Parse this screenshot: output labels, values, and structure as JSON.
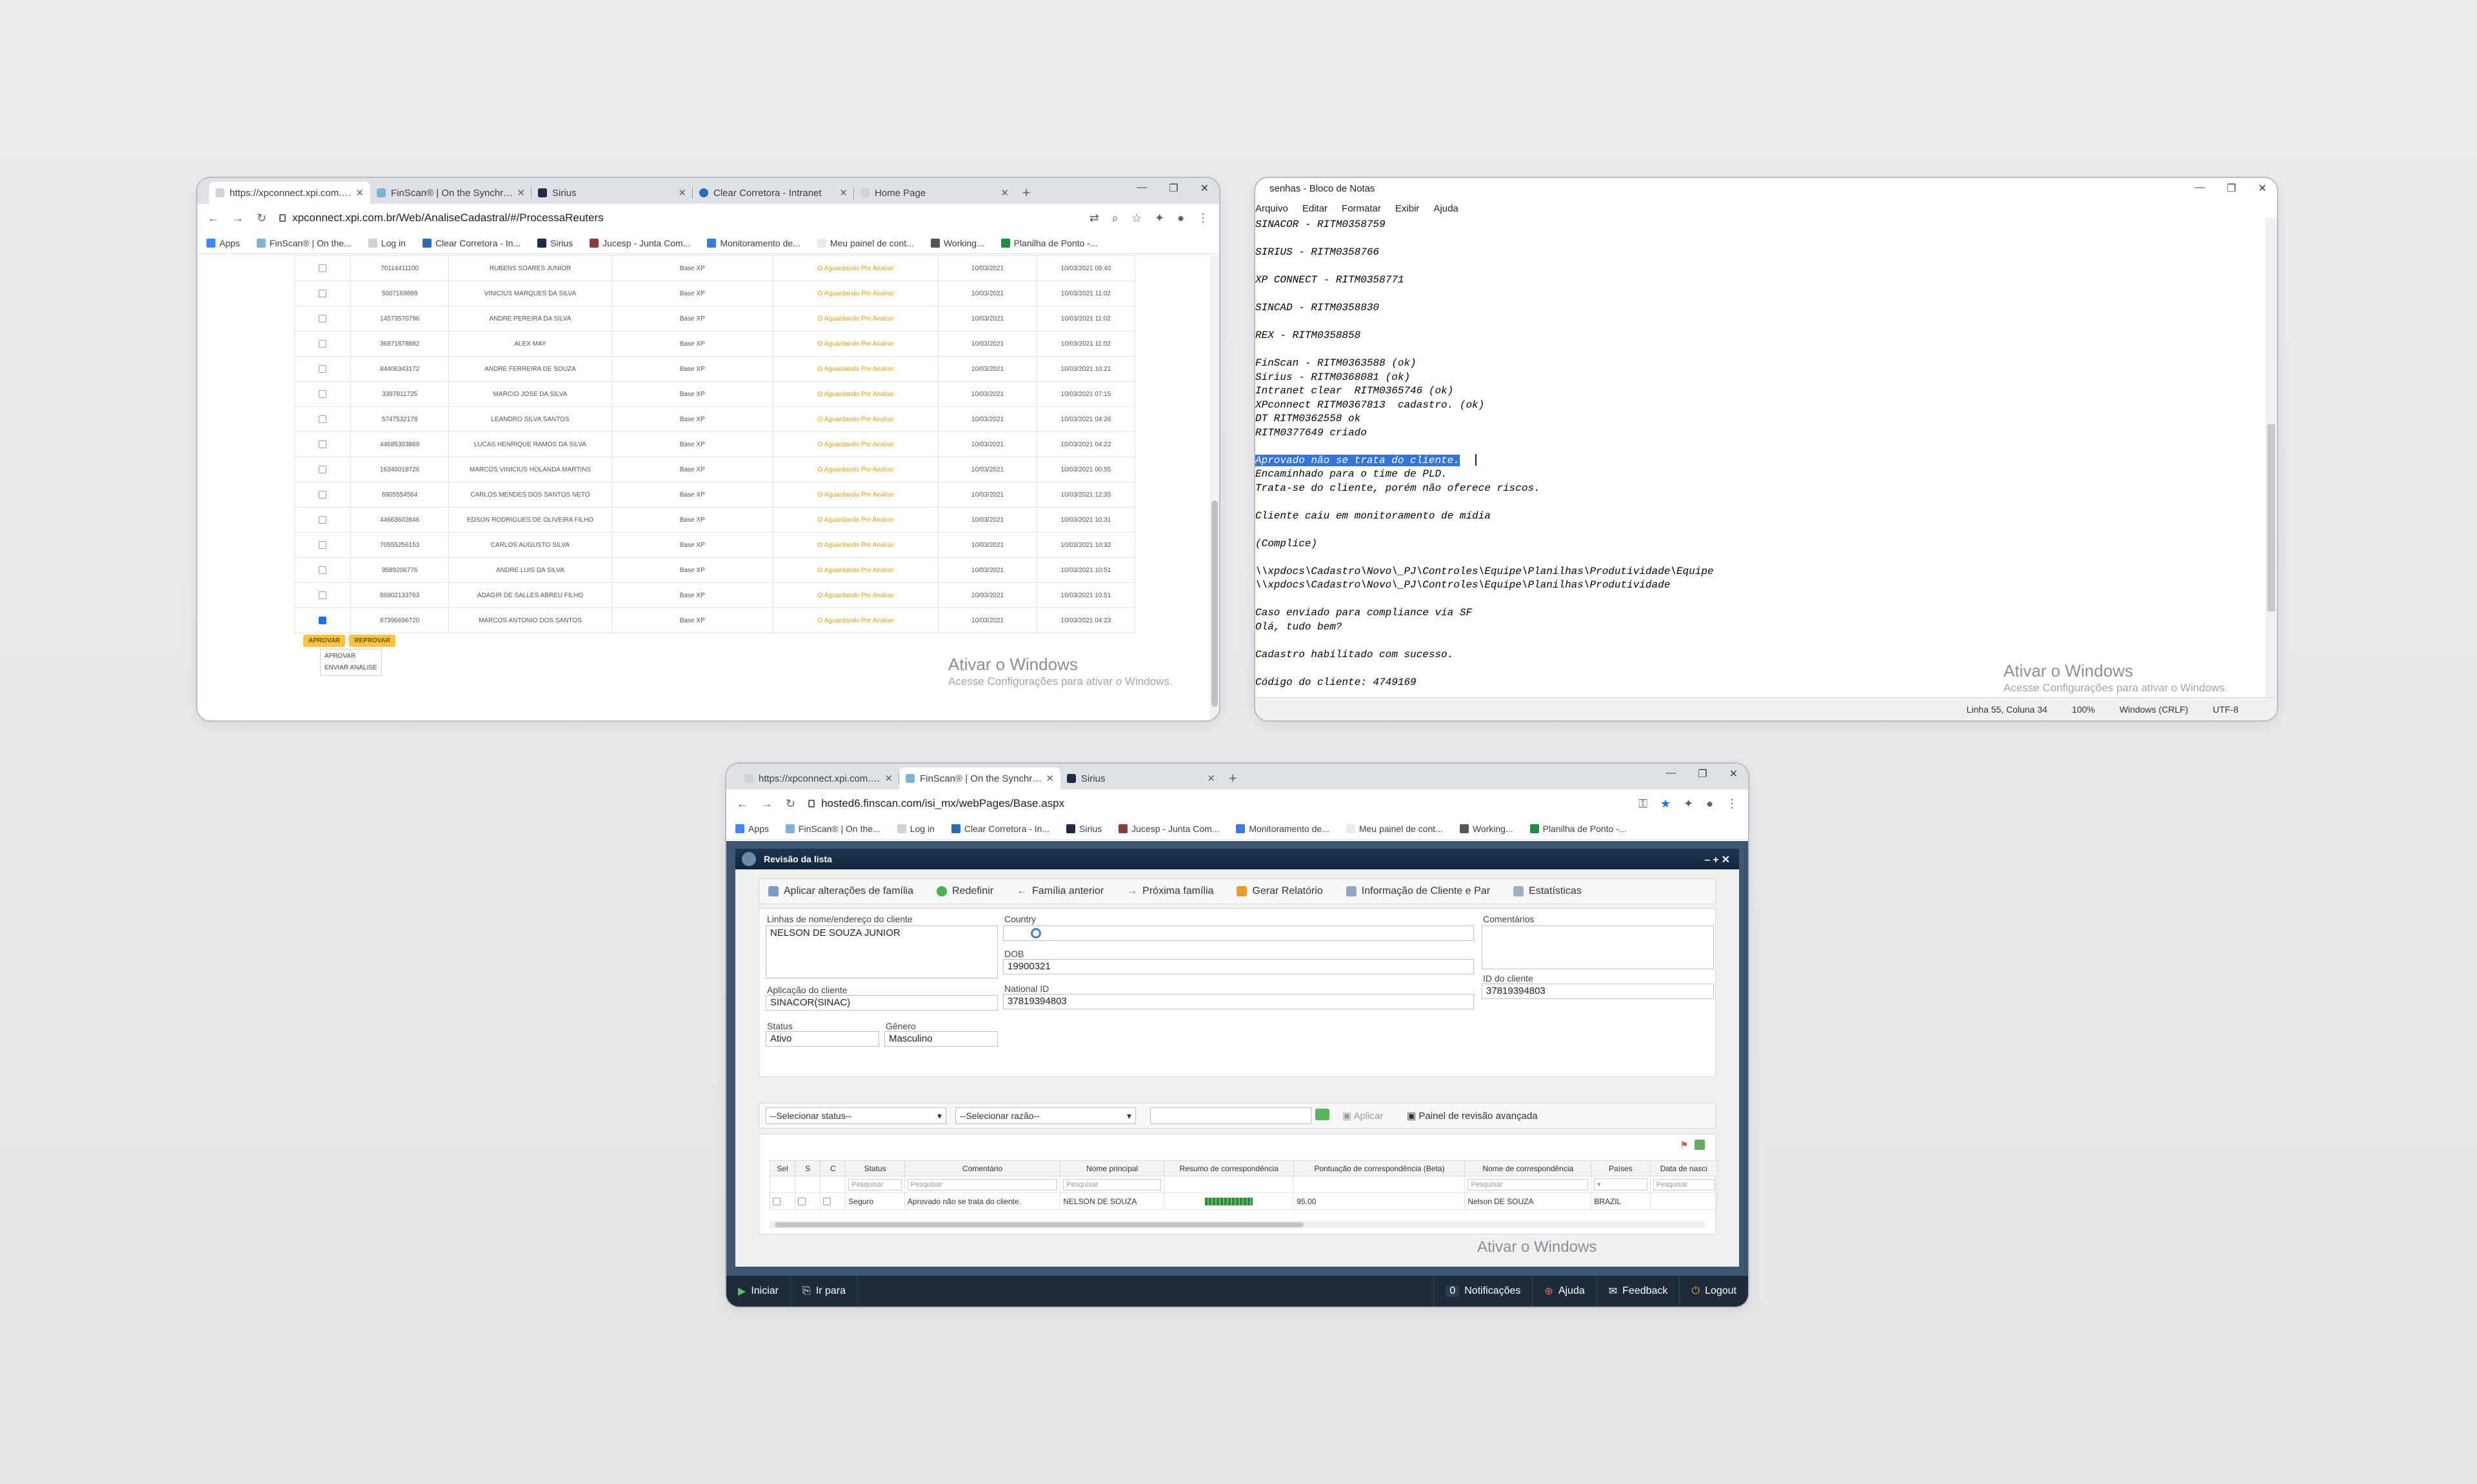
{
  "window1": {
    "tabs": [
      {
        "title": "https://xpconnect.xpi.com.br/Web",
        "active": true
      },
      {
        "title": "FinScan® | On the Synchronos",
        "active": false
      },
      {
        "title": "Sirius",
        "active": false
      },
      {
        "title": "Clear Corretora - Intranet",
        "active": false
      },
      {
        "title": "Home Page",
        "active": false
      }
    ],
    "url": "xpconnect.xpi.com.br/Web/AnaliseCadastral/#/ProcessaReuters",
    "bookmarks": [
      "Apps",
      "FinScan® | On the...",
      "Log in",
      "Clear Corretora - In...",
      "Sirius",
      "Jucesp - Junta Com...",
      "Monitoramento de...",
      "Meu painel de cont...",
      "Working...",
      "Planilha de Ponto -..."
    ],
    "rows": [
      {
        "id": "70114411100",
        "name": "RUBENS SOARES JUNIOR",
        "base": "Base XP",
        "status": "O Aguardando Pre Analise",
        "date": "10/03/2021",
        "datetime": "10/03/2021 09:40",
        "checked": false
      },
      {
        "id": "5007169899",
        "name": "VINICIUS MARQUES DA SILVA",
        "base": "Base XP",
        "status": "O Aguardando Pre Analise",
        "date": "10/03/2021",
        "datetime": "10/03/2021 11:02",
        "checked": false
      },
      {
        "id": "14573570796",
        "name": "ANDRE PEREIRA DA SILVA",
        "base": "Base XP",
        "status": "O Aguardando Pre Analise",
        "date": "10/03/2021",
        "datetime": "10/03/2021 11:02",
        "checked": false
      },
      {
        "id": "36871878882",
        "name": "ALEX MAY",
        "base": "Base XP",
        "status": "O Aguardando Pre Analise",
        "date": "10/03/2021",
        "datetime": "10/03/2021 11:02",
        "checked": false
      },
      {
        "id": "84406343172",
        "name": "ANDRE FERREIRA DE SOUZA",
        "base": "Base XP",
        "status": "O Aguardando Pre Analise",
        "date": "10/03/2021",
        "datetime": "10/03/2021 10:21",
        "checked": false
      },
      {
        "id": "3397811725",
        "name": "MARCIO JOSE DA SILVA",
        "base": "Base XP",
        "status": "O Aguardando Pre Analise",
        "date": "10/03/2021",
        "datetime": "10/03/2021 07:15",
        "checked": false
      },
      {
        "id": "5747532178",
        "name": "LEANDRO SILVA SANTOS",
        "base": "Base XP",
        "status": "O Aguardando Pre Analise",
        "date": "10/03/2021",
        "datetime": "10/03/2021 04:26",
        "checked": false
      },
      {
        "id": "44685303869",
        "name": "LUCAS HENRIQUE RAMOS DA SILVA",
        "base": "Base XP",
        "status": "O Aguardando Pre Analise",
        "date": "10/03/2021",
        "datetime": "10/03/2021 04:22",
        "checked": false
      },
      {
        "id": "16346018726",
        "name": "MARCOS VINICIUS HOLANDA MARTINS",
        "base": "Base XP",
        "status": "O Aguardando Pre Analise",
        "date": "10/03/2021",
        "datetime": "10/03/2021 00:55",
        "checked": false
      },
      {
        "id": "6905554564",
        "name": "CARLOS MENDES DOS SANTOS NETO",
        "base": "Base XP",
        "status": "O Aguardando Pre Analise",
        "date": "10/03/2021",
        "datetime": "10/03/2021 12:35",
        "checked": false
      },
      {
        "id": "44663602846",
        "name": "EDSON RODRIGUES DE OLIVEIRA FILHO",
        "base": "Base XP",
        "status": "O Aguardando Pre Analise",
        "date": "10/03/2021",
        "datetime": "10/03/2021 10:31",
        "checked": false
      },
      {
        "id": "70555256153",
        "name": "CARLOS AUGUSTO SILVA",
        "base": "Base XP",
        "status": "O Aguardando Pre Analise",
        "date": "10/03/2021",
        "datetime": "10/03/2021 10:32",
        "checked": false
      },
      {
        "id": "9589206776",
        "name": "ANDRE LUIS DA SILVA",
        "base": "Base XP",
        "status": "O Aguardando Pre Analise",
        "date": "10/03/2021",
        "datetime": "10/03/2021 10:51",
        "checked": false
      },
      {
        "id": "86902133763",
        "name": "ADAGIR DE SALLES ABREU FILHO",
        "base": "Base XP",
        "status": "O Aguardando Pre Analise",
        "date": "10/03/2021",
        "datetime": "10/03/2021 10:51",
        "checked": false
      },
      {
        "id": "87396696720",
        "name": "MARCOS ANTONIO DOS SANTOS",
        "base": "Base XP",
        "status": "O Aguardando Pre Analise",
        "date": "10/03/2021",
        "datetime": "10/03/2021 04:23",
        "checked": true
      }
    ],
    "btn_approve": "APROVAR",
    "btn_reject": "REPROVAR",
    "dropdown": [
      "APROVAR",
      "ENVIAR ANALISE"
    ],
    "watermark_title": "Ativar o Windows",
    "watermark_sub": "Acesse Configurações para ativar o Windows."
  },
  "notepad": {
    "title": "senhas - Bloco de Notas",
    "menu": [
      "Arquivo",
      "Editar",
      "Formatar",
      "Exibir",
      "Ajuda"
    ],
    "lines": [
      "SINACOR - RITM0358759",
      "",
      "SIRIUS - RITM0358766",
      "",
      "XP CONNECT - RITM0358771",
      "",
      "SINCAD - RITM0358830",
      "",
      "REX - RITM0358858",
      "",
      "FinScan - RITM0363588 (ok)",
      "Sirius - RITM0368081 (ok)",
      "Intranet clear  RITM0365746 (ok)",
      "XPconnect RITM0367813  cadastro. (ok)",
      "DT RITM0362558 ok",
      "RITM0377649 criado",
      "",
      "Aprovado não se trata do cliente.",
      "Encaminhado para o time de PLD.",
      "Trata-se do cliente, porém não oferece riscos.",
      "",
      "Cliente caiu em monitoramento de mídia",
      "",
      "(Complice)",
      "",
      "\\\\xpdocs\\Cadastro\\Novo\\_PJ\\Controles\\Equipe\\Planilhas\\Produtividade\\Equipe",
      "\\\\xpdocs\\Cadastro\\Novo\\_PJ\\Controles\\Equipe\\Planilhas\\Produtividade",
      "",
      "Caso enviado para compliance via SF",
      "Olá, tudo bem?",
      "",
      "Cadastro habilitado com sucesso.",
      "",
      "Código do cliente: 4749169"
    ],
    "selected_line_index": 17,
    "status": {
      "position": "Linha 55, Coluna 34",
      "zoom": "100%",
      "eol": "Windows (CRLF)",
      "encoding": "UTF-8"
    },
    "watermark_title": "Ativar o Windows",
    "watermark_sub": "Acesse Configurações para ativar o Windows."
  },
  "window3": {
    "tabs": [
      {
        "title": "https://xpconnect.xpi.com.br/We",
        "active": false
      },
      {
        "title": "FinScan® | On the Synchronos P",
        "active": true
      },
      {
        "title": "Sirius",
        "active": false
      }
    ],
    "url": "hosted6.finscan.com/isi_mx/webPages/Base.aspx",
    "bookmarks": [
      "Apps",
      "FinScan® | On the...",
      "Log in",
      "Clear Corretora - In...",
      "Sirius",
      "Jucesp - Junta Com...",
      "Monitoramento de...",
      "Meu painel de cont...",
      "Working...",
      "Planilha de Ponto -..."
    ],
    "panel_title": "Revisão da lista",
    "toolbar": [
      "Aplicar alterações de família",
      "Redefinir",
      "Família anterior",
      "Próxima família",
      "Gerar Relatório",
      "Informação de Cliente e Par",
      "Estatísticas"
    ],
    "form": {
      "name_label": "Linhas de nome/endereço do cliente",
      "name_value": "NELSON DE SOUZA JUNIOR",
      "country_label": "Country",
      "comments_label": "Comentários",
      "dob_label": "DOB",
      "dob_value": "19900321",
      "app_label": "Aplicação do cliente",
      "app_value": "SINACOR(SINAC)",
      "national_label": "National ID",
      "national_value": "37819394803",
      "client_id_label": "ID do cliente",
      "client_id_value": "37819394803",
      "status_label": "Status",
      "status_value": "Ativo",
      "gender_label": "Gênero",
      "gender_value": "Masculino"
    },
    "filter": {
      "status_select": "--Selecionar status--",
      "reason_select": "--Selecionar razão--",
      "apply": "Aplicar",
      "advanced": "Painel de revisão avançada"
    },
    "grid": {
      "headers": [
        "Sel",
        "S",
        "C",
        "Status",
        "Comentário",
        "Nome principal",
        "Resumo de correspondência",
        "Pontuação de correspondência (Beta)",
        "Nome de correspondência",
        "Países",
        "Data de nasci"
      ],
      "search_placeholder": "Pesquisar",
      "row": {
        "status": "Seguro",
        "comment": "Aprovado não se trata do cliente.",
        "principal": "NELSON DE SOUZA",
        "score": "95.00",
        "match_name": "Nelson DE SOUZA",
        "country": "BRAZIL"
      }
    },
    "footer": {
      "start": "Iniciar",
      "goto": "Ir para",
      "notif_count": "0",
      "notifications": "Notificações",
      "help": "Ajuda",
      "feedback": "Feedback",
      "logout": "Logout"
    },
    "watermark_title": "Ativar o Windows"
  }
}
